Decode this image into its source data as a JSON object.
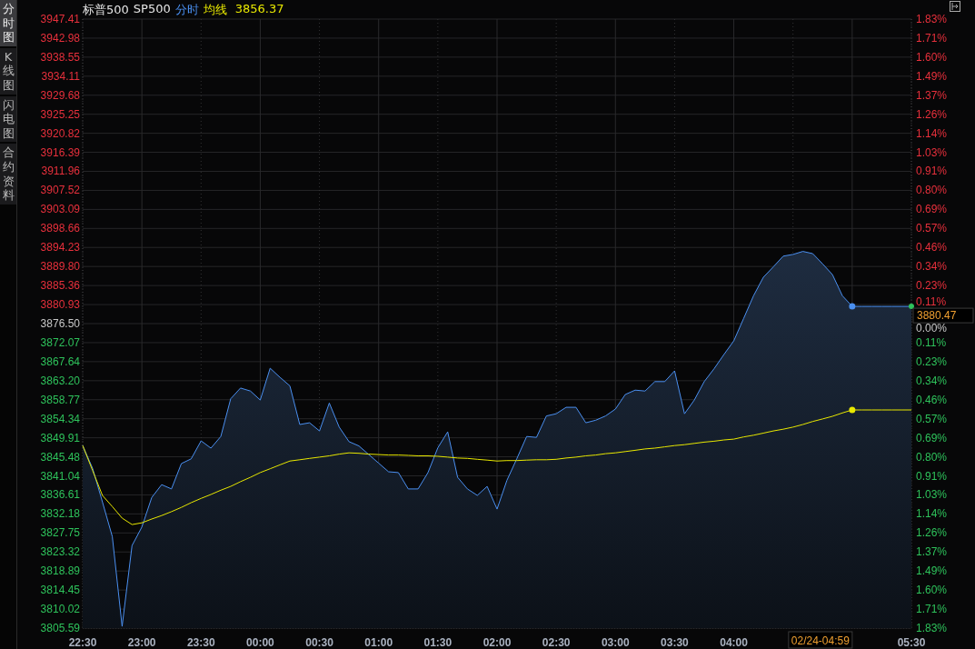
{
  "side_tabs": [
    {
      "label": "分时图",
      "selected": true
    },
    {
      "label": "K线图",
      "selected": false
    },
    {
      "label": "闪电图",
      "selected": false
    },
    {
      "label": "合约资料",
      "selected": false
    }
  ],
  "header": {
    "title": "标普500",
    "code": "SP500",
    "avg_value": "3856.37"
  },
  "chart": {
    "chart_data": {
      "type": "area",
      "grid": true,
      "ylim": [
        3805.59,
        3947.41
      ],
      "categories": [
        "22:30",
        null,
        null,
        null,
        null,
        null,
        "23:00",
        null,
        null,
        null,
        null,
        null,
        "23:30",
        null,
        null,
        null,
        null,
        null,
        "00:00",
        null,
        null,
        null,
        null,
        null,
        "00:30",
        null,
        null,
        null,
        null,
        null,
        "01:00",
        null,
        null,
        null,
        null,
        null,
        "01:30",
        null,
        null,
        null,
        null,
        null,
        "02:00",
        null,
        null,
        null,
        null,
        null,
        "02:30",
        null,
        null,
        null,
        null,
        null,
        "03:00",
        null,
        null,
        null,
        null,
        null,
        "03:30",
        null,
        null,
        null,
        null,
        null,
        "04:00",
        null,
        null,
        null,
        null,
        null,
        null,
        null,
        null,
        null,
        null,
        null,
        null,
        null,
        null,
        null,
        null,
        null,
        "05:30"
      ],
      "yticks": [
        {
          "value": 3947.41,
          "label": "3947.41"
        },
        {
          "value": 3942.98,
          "label": "3942.98"
        },
        {
          "value": 3938.55,
          "label": "3938.55"
        },
        {
          "value": 3934.11,
          "label": "3934.11"
        },
        {
          "value": 3929.68,
          "label": "3929.68"
        },
        {
          "value": 3925.25,
          "label": "3925.25"
        },
        {
          "value": 3920.82,
          "label": "3920.82"
        },
        {
          "value": 3916.39,
          "label": "3916.39"
        },
        {
          "value": 3911.96,
          "label": "3911.96"
        },
        {
          "value": 3907.52,
          "label": "3907.52"
        },
        {
          "value": 3903.09,
          "label": "3903.09"
        },
        {
          "value": 3898.66,
          "label": "3898.66"
        },
        {
          "value": 3894.23,
          "label": "3894.23"
        },
        {
          "value": 3889.8,
          "label": "3889.80"
        },
        {
          "value": 3885.36,
          "label": "3885.36"
        },
        {
          "value": 3880.93,
          "label": "3880.93"
        },
        {
          "value": 3876.5,
          "label": "3876.50"
        },
        {
          "value": 3872.07,
          "label": "3872.07"
        },
        {
          "value": 3867.64,
          "label": "3867.64"
        },
        {
          "value": 3863.2,
          "label": "3863.20"
        },
        {
          "value": 3858.77,
          "label": "3858.77"
        },
        {
          "value": 3854.34,
          "label": "3854.34"
        },
        {
          "value": 3849.91,
          "label": "3849.91"
        },
        {
          "value": 3845.48,
          "label": "3845.48"
        },
        {
          "value": 3841.04,
          "label": "3841.04"
        },
        {
          "value": 3836.61,
          "label": "3836.61"
        },
        {
          "value": 3832.18,
          "label": "3832.18"
        },
        {
          "value": 3827.75,
          "label": "3827.75"
        },
        {
          "value": 3823.32,
          "label": "3823.32"
        },
        {
          "value": 3818.89,
          "label": "3818.89"
        },
        {
          "value": 3814.45,
          "label": "3814.45"
        },
        {
          "value": 3810.02,
          "label": "3810.02"
        },
        {
          "value": 3805.59,
          "label": "3805.59"
        }
      ],
      "series": [
        {
          "name": "分时",
          "color": "#4a8ff0",
          "values": [
            3848.1,
            3842.8,
            3835.0,
            3826.9,
            3806.0,
            3824.8,
            3829.1,
            3836.0,
            3839.0,
            3838.0,
            3843.9,
            3845.0,
            3849.2,
            3847.5,
            3850.2,
            3859.0,
            3861.5,
            3860.8,
            3858.7,
            3866.1,
            3864.0,
            3862.0,
            3853.0,
            3853.4,
            3851.5,
            3858.0,
            3852.4,
            3849.0,
            3848.0,
            3846.0,
            3844.0,
            3842.0,
            3841.8,
            3838.0,
            3838.0,
            3841.8,
            3847.6,
            3851.3,
            3840.7,
            3838.0,
            3836.5,
            3838.6,
            3833.3,
            3840.0,
            3845.0,
            3850.2,
            3850.0,
            3855.0,
            3855.5,
            3857.0,
            3857.0,
            3853.4,
            3854.0,
            3855.0,
            3856.6,
            3860.0,
            3861.0,
            3860.8,
            3863.0,
            3863.0,
            3865.5,
            3855.5,
            3858.7,
            3863.0,
            3866.0,
            3869.3,
            3872.5,
            3877.7,
            3883.0,
            3887.3,
            3889.7,
            3892.2,
            3892.6,
            3893.3,
            3892.8,
            3890.4,
            3887.9,
            3883.0,
            3880.5,
            3880.5,
            3880.5,
            3880.5,
            3880.5,
            3880.5,
            3880.5
          ]
        },
        {
          "name": "均线",
          "color": "#e8e800",
          "type": "line",
          "values": [
            3848.1,
            3842.3,
            3836.5,
            3833.9,
            3831.2,
            3829.7,
            3830.1,
            3831.0,
            3831.8,
            3832.7,
            3833.7,
            3834.8,
            3835.8,
            3836.7,
            3837.7,
            3838.6,
            3839.7,
            3840.7,
            3841.8,
            3842.7,
            3843.6,
            3844.5,
            3844.8,
            3845.1,
            3845.4,
            3845.7,
            3846.1,
            3846.4,
            3846.3,
            3846.1,
            3846.0,
            3845.9,
            3845.9,
            3845.8,
            3845.7,
            3845.7,
            3845.6,
            3845.4,
            3845.2,
            3845.1,
            3844.9,
            3844.7,
            3844.5,
            3844.6,
            3844.6,
            3844.7,
            3844.8,
            3844.8,
            3844.9,
            3845.2,
            3845.4,
            3845.7,
            3845.9,
            3846.2,
            3846.4,
            3846.7,
            3847.0,
            3847.3,
            3847.5,
            3847.8,
            3848.1,
            3848.3,
            3848.6,
            3848.9,
            3849.1,
            3849.4,
            3849.6,
            3850.1,
            3850.5,
            3851.0,
            3851.5,
            3851.9,
            3852.4,
            3853.0,
            3853.7,
            3854.3,
            3854.9,
            3855.7,
            3856.4,
            3856.4,
            3856.4,
            3856.4,
            3856.4,
            3856.4,
            3856.4
          ]
        }
      ]
    },
    "percent_labels": [
      "1.83%",
      "1.71%",
      "1.60%",
      "1.49%",
      "1.37%",
      "1.26%",
      "1.14%",
      "1.03%",
      "0.91%",
      "0.80%",
      "0.69%",
      "0.57%",
      "0.46%",
      "0.34%",
      "0.23%",
      "0.11%",
      "0.00%",
      "0.11%",
      "0.23%",
      "0.34%",
      "0.46%",
      "0.57%",
      "0.69%",
      "0.80%",
      "0.91%",
      "1.03%",
      "1.14%",
      "1.26%",
      "1.37%",
      "1.49%",
      "1.60%",
      "1.71%",
      "1.83%"
    ],
    "last_price": "3880.47",
    "cursor_time": "02/24-04:59"
  }
}
